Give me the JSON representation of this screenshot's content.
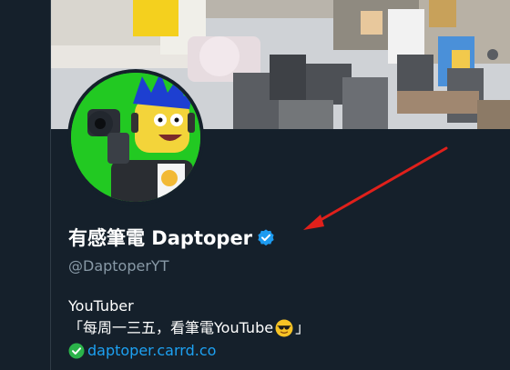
{
  "profile": {
    "display_name": "有感筆電 Daptoper",
    "handle": "@DaptoperYT",
    "bio_line1": "YouTuber",
    "bio_line2_prefix": "「每周一三五，看筆電YouTube",
    "bio_line2_suffix": "」",
    "website": "daptoper.carrd.co",
    "verified": true
  },
  "icons": {
    "verified": "verified-badge-icon",
    "bio_emoji": "sunglasses-emoji-icon",
    "website_prefix": "green-check-icon"
  },
  "colors": {
    "background": "#15202b",
    "display_name": "#ffffff",
    "handle": "#8899a6",
    "link": "#1da1f2",
    "verified_badge": "#1d9bf0",
    "annotation_arrow": "#e0201b"
  }
}
